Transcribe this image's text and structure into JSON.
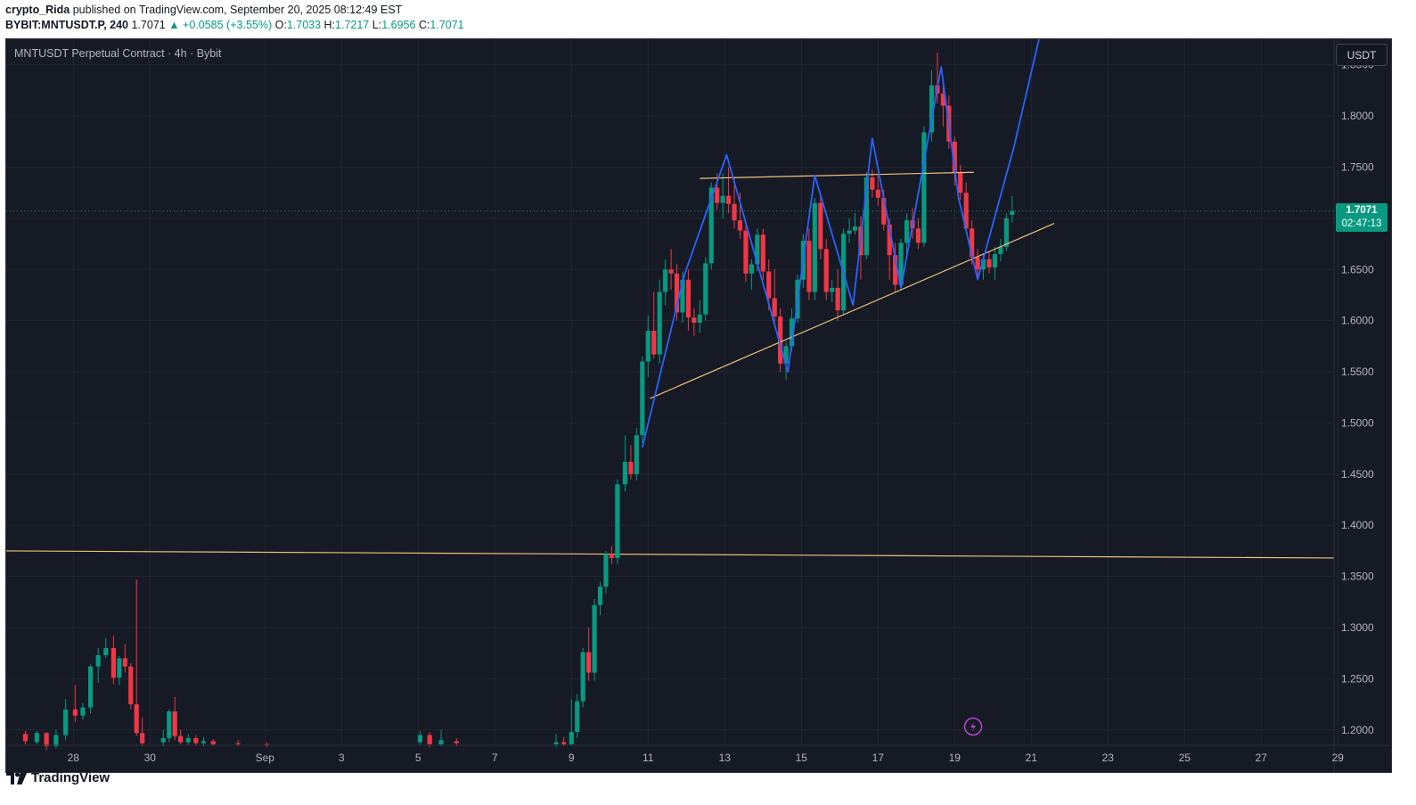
{
  "header": {
    "author": "crypto_Rida",
    "published_text": "published on TradingView.com, September 20, 2025 08:12:49 EST",
    "symbol": "BYBIT:MNTUSDT.P, 240",
    "last": "1.7071",
    "change": "▲ +0.0585 (+3.55%)",
    "o_label": "O:",
    "o": "1.7033",
    "h_label": "H:",
    "h": "1.7217",
    "l_label": "L:",
    "l": "1.6956",
    "c_label": "C:",
    "c": "1.7071"
  },
  "chart_title": "MNTUSDT Perpetual Contract · 4h · Bybit",
  "currency_button": "USDT",
  "price_tag": {
    "price": "1.7071",
    "countdown": "02:47:13"
  },
  "footer": {
    "brand": "TradingView",
    "logo_icon": "tradingview-logo-icon"
  },
  "colors": {
    "background": "#161a25",
    "up": "#089981",
    "down": "#f23645",
    "trend_lines": "#f0c27b",
    "pattern_line": "#2962ff"
  },
  "chart_data": {
    "type": "candlestick",
    "title": "MNTUSDT Perpetual Contract · 4h · Bybit",
    "y_ticks": [
      "1.8500",
      "1.8000",
      "1.7500",
      "1.7000",
      "1.6500",
      "1.6000",
      "1.5500",
      "1.5000",
      "1.4500",
      "1.4000",
      "1.3500",
      "1.3000",
      "1.2500",
      "1.2000"
    ],
    "y_range": [
      1.185,
      1.875
    ],
    "x_ticks": [
      "28",
      "30",
      "Sep",
      "3",
      "5",
      "7",
      "9",
      "11",
      "13",
      "15",
      "17",
      "19",
      "21",
      "23",
      "25",
      "27",
      "29"
    ],
    "x_tick_days": [
      -4,
      -2,
      1,
      3,
      5,
      7,
      9,
      11,
      13,
      15,
      17,
      19,
      21,
      23,
      25,
      27,
      29
    ],
    "x_range_days": [
      -5.75,
      28.9
    ],
    "last_price": 1.7071,
    "candles": [
      [
        -5.25,
        1.196,
        1.199,
        1.186,
        1.189
      ],
      [
        -4.95,
        1.188,
        1.199,
        1.186,
        1.197
      ],
      [
        -4.7,
        1.197,
        1.198,
        1.18,
        1.184
      ],
      [
        -4.45,
        1.184,
        1.2,
        1.182,
        1.195
      ],
      [
        -4.2,
        1.195,
        1.23,
        1.19,
        1.22
      ],
      [
        -3.95,
        1.22,
        1.244,
        1.208,
        1.214
      ],
      [
        -3.75,
        1.214,
        1.226,
        1.21,
        1.222
      ],
      [
        -3.55,
        1.222,
        1.264,
        1.216,
        1.262
      ],
      [
        -3.35,
        1.262,
        1.28,
        1.246,
        1.273
      ],
      [
        -3.15,
        1.273,
        1.29,
        1.27,
        1.28
      ],
      [
        -2.95,
        1.28,
        1.292,
        1.245,
        1.251
      ],
      [
        -2.8,
        1.251,
        1.272,
        1.244,
        1.27
      ],
      [
        -2.65,
        1.27,
        1.284,
        1.256,
        1.262
      ],
      [
        -2.5,
        1.262,
        1.265,
        1.22,
        1.225
      ],
      [
        -2.35,
        1.225,
        1.347,
        1.194,
        1.197
      ],
      [
        -2.2,
        1.197,
        1.212,
        1.184,
        1.187
      ],
      [
        -1.65,
        1.188,
        1.2,
        1.184,
        1.192
      ],
      [
        -1.5,
        1.192,
        1.22,
        1.188,
        1.218
      ],
      [
        -1.35,
        1.218,
        1.232,
        1.19,
        1.194
      ],
      [
        -1.2,
        1.194,
        1.2,
        1.186,
        1.188
      ],
      [
        -1.0,
        1.188,
        1.196,
        1.185,
        1.192
      ],
      [
        -0.8,
        1.192,
        1.195,
        1.185,
        1.187
      ],
      [
        -0.6,
        1.187,
        1.193,
        1.184,
        1.189
      ],
      [
        -0.35,
        1.189,
        1.191,
        1.184,
        1.186
      ],
      [
        0.3,
        1.187,
        1.19,
        1.184,
        1.186
      ],
      [
        1.05,
        1.186,
        1.188,
        1.183,
        1.185
      ],
      [
        5.05,
        1.188,
        1.199,
        1.185,
        1.195
      ],
      [
        5.3,
        1.195,
        1.198,
        1.183,
        1.186
      ],
      [
        5.6,
        1.186,
        1.2,
        1.184,
        1.19
      ],
      [
        6.0,
        1.189,
        1.192,
        1.184,
        1.187
      ],
      [
        8.6,
        1.186,
        1.196,
        1.183,
        1.188
      ],
      [
        8.8,
        1.188,
        1.193,
        1.184,
        1.186
      ],
      [
        9.0,
        1.186,
        1.23,
        1.185,
        1.198
      ],
      [
        9.15,
        1.198,
        1.235,
        1.192,
        1.228
      ],
      [
        9.3,
        1.228,
        1.28,
        1.222,
        1.276
      ],
      [
        9.45,
        1.276,
        1.3,
        1.248,
        1.256
      ],
      [
        9.6,
        1.256,
        1.328,
        1.248,
        1.322
      ],
      [
        9.75,
        1.322,
        1.345,
        1.312,
        1.34
      ],
      [
        9.9,
        1.34,
        1.375,
        1.333,
        1.372
      ],
      [
        10.05,
        1.372,
        1.38,
        1.362,
        1.368
      ],
      [
        10.2,
        1.368,
        1.445,
        1.362,
        1.44
      ],
      [
        10.4,
        1.44,
        1.488,
        1.433,
        1.462
      ],
      [
        10.55,
        1.462,
        1.478,
        1.445,
        1.45
      ],
      [
        10.7,
        1.45,
        1.495,
        1.444,
        1.488
      ],
      [
        10.85,
        1.488,
        1.565,
        1.48,
        1.56
      ],
      [
        11.0,
        1.56,
        1.605,
        1.545,
        1.59
      ],
      [
        11.15,
        1.59,
        1.628,
        1.563,
        1.567
      ],
      [
        11.3,
        1.567,
        1.64,
        1.558,
        1.628
      ],
      [
        11.45,
        1.628,
        1.66,
        1.615,
        1.65
      ],
      [
        11.6,
        1.65,
        1.67,
        1.63,
        1.646
      ],
      [
        11.75,
        1.646,
        1.655,
        1.6,
        1.608
      ],
      [
        11.9,
        1.608,
        1.648,
        1.598,
        1.64
      ],
      [
        12.05,
        1.64,
        1.65,
        1.59,
        1.603
      ],
      [
        12.2,
        1.603,
        1.612,
        1.585,
        1.598
      ],
      [
        12.35,
        1.598,
        1.62,
        1.588,
        1.606
      ],
      [
        12.5,
        1.606,
        1.662,
        1.6,
        1.656
      ],
      [
        12.65,
        1.656,
        1.735,
        1.65,
        1.73
      ],
      [
        12.8,
        1.73,
        1.744,
        1.708,
        1.715
      ],
      [
        12.95,
        1.715,
        1.744,
        1.7,
        1.722
      ],
      [
        13.1,
        1.722,
        1.75,
        1.705,
        1.714
      ],
      [
        13.25,
        1.714,
        1.74,
        1.69,
        1.698
      ],
      [
        13.4,
        1.698,
        1.725,
        1.68,
        1.688
      ],
      [
        13.55,
        1.688,
        1.695,
        1.638,
        1.646
      ],
      [
        13.7,
        1.646,
        1.66,
        1.63,
        1.655
      ],
      [
        13.85,
        1.655,
        1.69,
        1.648,
        1.684
      ],
      [
        14.0,
        1.684,
        1.69,
        1.64,
        1.648
      ],
      [
        14.15,
        1.648,
        1.66,
        1.61,
        1.622
      ],
      [
        14.3,
        1.622,
        1.65,
        1.598,
        1.604
      ],
      [
        14.45,
        1.604,
        1.612,
        1.55,
        1.558
      ],
      [
        14.6,
        1.558,
        1.58,
        1.542,
        1.575
      ],
      [
        14.75,
        1.575,
        1.612,
        1.57,
        1.602
      ],
      [
        14.9,
        1.602,
        1.645,
        1.598,
        1.64
      ],
      [
        15.05,
        1.64,
        1.685,
        1.632,
        1.678
      ],
      [
        15.2,
        1.678,
        1.69,
        1.62,
        1.628
      ],
      [
        15.35,
        1.628,
        1.72,
        1.62,
        1.715
      ],
      [
        15.5,
        1.715,
        1.722,
        1.66,
        1.67
      ],
      [
        15.65,
        1.67,
        1.68,
        1.62,
        1.628
      ],
      [
        15.8,
        1.628,
        1.64,
        1.618,
        1.632
      ],
      [
        15.95,
        1.632,
        1.65,
        1.6,
        1.61
      ],
      [
        16.1,
        1.61,
        1.69,
        1.605,
        1.685
      ],
      [
        16.25,
        1.685,
        1.7,
        1.676,
        1.688
      ],
      [
        16.4,
        1.688,
        1.705,
        1.684,
        1.692
      ],
      [
        16.55,
        1.692,
        1.702,
        1.64,
        1.664
      ],
      [
        16.7,
        1.664,
        1.745,
        1.66,
        1.74
      ],
      [
        16.85,
        1.74,
        1.748,
        1.72,
        1.728
      ],
      [
        17.0,
        1.728,
        1.742,
        1.712,
        1.72
      ],
      [
        17.15,
        1.72,
        1.728,
        1.688,
        1.694
      ],
      [
        17.3,
        1.694,
        1.7,
        1.64,
        1.664
      ],
      [
        17.45,
        1.664,
        1.676,
        1.628,
        1.635
      ],
      [
        17.6,
        1.635,
        1.68,
        1.63,
        1.676
      ],
      [
        17.75,
        1.676,
        1.705,
        1.664,
        1.698
      ],
      [
        17.9,
        1.698,
        1.71,
        1.68,
        1.69
      ],
      [
        18.05,
        1.69,
        1.7,
        1.67,
        1.676
      ],
      [
        18.2,
        1.676,
        1.79,
        1.672,
        1.784
      ],
      [
        18.4,
        1.784,
        1.845,
        1.775,
        1.83
      ],
      [
        18.55,
        1.83,
        1.862,
        1.812,
        1.822
      ],
      [
        18.7,
        1.822,
        1.835,
        1.79,
        1.81
      ],
      [
        18.85,
        1.81,
        1.82,
        1.768,
        1.775
      ],
      [
        19.0,
        1.775,
        1.78,
        1.732,
        1.745
      ],
      [
        19.15,
        1.745,
        1.752,
        1.718,
        1.725
      ],
      [
        19.3,
        1.725,
        1.735,
        1.685,
        1.69
      ],
      [
        19.45,
        1.69,
        1.698,
        1.655,
        1.662
      ],
      [
        19.6,
        1.662,
        1.67,
        1.642,
        1.65
      ],
      [
        19.75,
        1.65,
        1.665,
        1.64,
        1.66
      ],
      [
        19.9,
        1.66,
        1.668,
        1.646,
        1.652
      ],
      [
        20.05,
        1.652,
        1.672,
        1.64,
        1.665
      ],
      [
        20.2,
        1.665,
        1.68,
        1.658,
        1.672
      ],
      [
        20.35,
        1.672,
        1.705,
        1.668,
        1.7
      ],
      [
        20.5,
        1.7033,
        1.7217,
        1.6956,
        1.7071
      ]
    ],
    "drawings": {
      "support_line": [
        [
          -5.75,
          1.375
        ],
        [
          28.9,
          1.368
        ]
      ],
      "rising_trendline": [
        [
          11.05,
          1.524
        ],
        [
          21.6,
          1.695
        ]
      ],
      "resistance_line": [
        [
          12.35,
          1.739
        ],
        [
          19.5,
          1.745
        ]
      ],
      "pattern_path": [
        [
          10.85,
          1.476
        ],
        [
          11.95,
          1.645
        ],
        [
          13.05,
          1.762
        ],
        [
          14.65,
          1.55
        ],
        [
          15.35,
          1.742
        ],
        [
          16.35,
          1.615
        ],
        [
          16.85,
          1.778
        ],
        [
          17.6,
          1.632
        ],
        [
          18.2,
          1.755
        ],
        [
          18.65,
          1.848
        ],
        [
          19.1,
          1.72
        ],
        [
          19.6,
          1.64
        ],
        [
          20.55,
          1.77
        ],
        [
          21.2,
          1.875
        ]
      ]
    }
  }
}
